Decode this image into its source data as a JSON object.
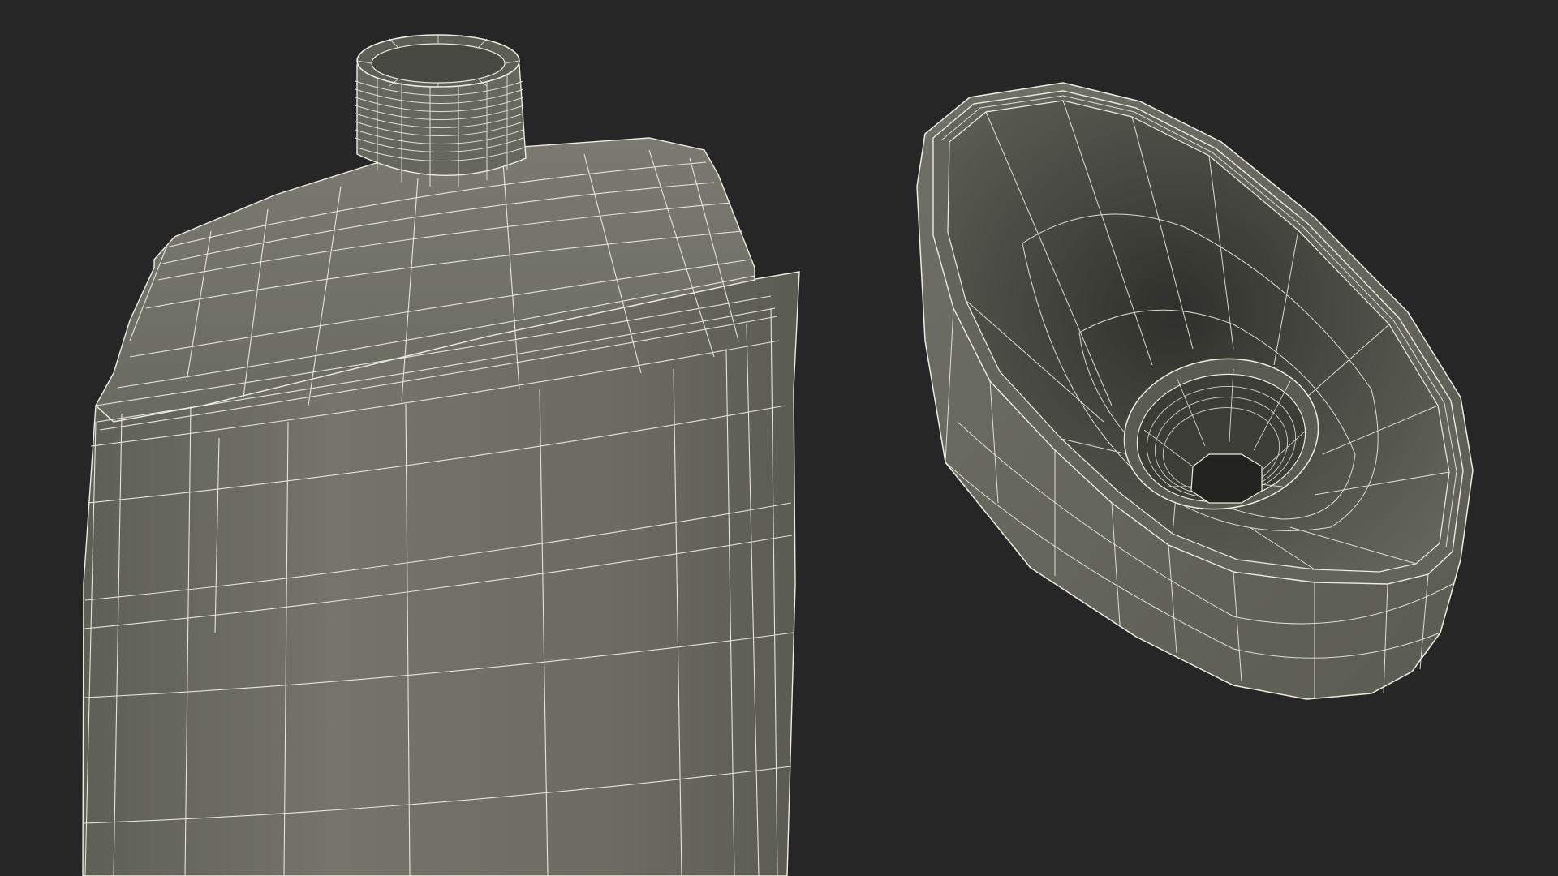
{
  "scene": {
    "background": "#262626",
    "objects": [
      {
        "name": "bottle-body-wireframe",
        "surface_color": "#6e6e65",
        "wire_color": "#ecece0"
      },
      {
        "name": "bottle-cap-wireframe",
        "surface_color": "#54554d",
        "wire_color": "#ecece0"
      }
    ]
  }
}
